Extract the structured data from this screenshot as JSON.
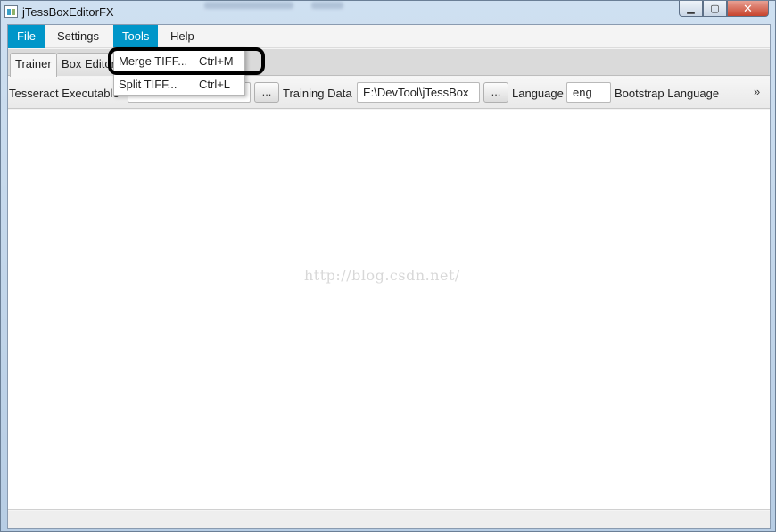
{
  "window": {
    "title": "jTessBoxEditorFX",
    "controls": {
      "minimize": "▁",
      "maximize": "▢",
      "close": "✕"
    }
  },
  "menubar": {
    "items": [
      {
        "label": "File",
        "active": true
      },
      {
        "label": "Settings",
        "active": false
      },
      {
        "label": "Tools",
        "active": true
      },
      {
        "label": "Help",
        "active": false
      }
    ]
  },
  "tabs": [
    {
      "label": "Trainer",
      "selected": true
    },
    {
      "label": "Box Editor",
      "selected": false
    }
  ],
  "toolbar": {
    "tesseract_label": "Tesseract Executable",
    "tesseract_value": "",
    "browse1": "...",
    "training_label": "Training Data",
    "training_value": "E:\\DevTool\\jTessBox",
    "browse2": "...",
    "language_label": "Language",
    "language_value": "eng",
    "bootstrap_label": "Bootstrap Language",
    "overflow": "»"
  },
  "tools_menu": {
    "items": [
      {
        "label": "Merge TIFF...",
        "accelerator": "Ctrl+M"
      },
      {
        "label": "Split TIFF...",
        "accelerator": "Ctrl+L"
      }
    ]
  },
  "watermark": "http://blog.csdn.net/",
  "colors": {
    "menu_active": "#0096c9",
    "highlight_ring": "#000000"
  }
}
